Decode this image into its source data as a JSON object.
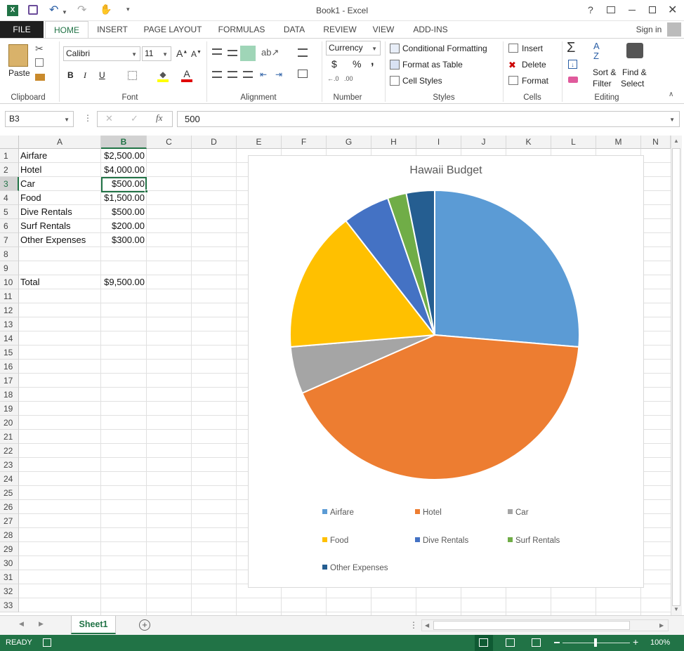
{
  "window": {
    "title": "Book1 - Excel",
    "help": "?",
    "signin": "Sign in"
  },
  "tabs": [
    "FILE",
    "HOME",
    "INSERT",
    "PAGE LAYOUT",
    "FORMULAS",
    "DATA",
    "REVIEW",
    "VIEW",
    "ADD-INS"
  ],
  "ribbon": {
    "clipboard": {
      "label": "Clipboard",
      "paste": "Paste"
    },
    "font": {
      "label": "Font",
      "name": "Calibri",
      "size": "11",
      "bold": "B",
      "italic": "I",
      "underline": "U"
    },
    "alignment": {
      "label": "Alignment"
    },
    "number": {
      "label": "Number",
      "format": "Currency",
      "currency_sym": "$",
      "percent_sym": "%",
      "comma_sym": ","
    },
    "styles": {
      "label": "Styles",
      "conditional": "Conditional Formatting",
      "format_table": "Format as Table",
      "cell_styles": "Cell Styles"
    },
    "cells": {
      "label": "Cells",
      "insert": "Insert",
      "delete": "Delete",
      "format": "Format"
    },
    "editing": {
      "label": "Editing",
      "sort1": "Sort &",
      "sort2": "Filter",
      "find1": "Find &",
      "find2": "Select"
    }
  },
  "formula_bar": {
    "name_box": "B3",
    "fx": "fx",
    "value": "500"
  },
  "columns": [
    "A",
    "B",
    "C",
    "D",
    "E",
    "F",
    "G",
    "H",
    "I",
    "J",
    "K",
    "L",
    "M",
    "N"
  ],
  "rows": [
    "1",
    "2",
    "3",
    "4",
    "5",
    "6",
    "7",
    "8",
    "9",
    "10",
    "11",
    "12",
    "13",
    "14",
    "15",
    "16",
    "17",
    "18",
    "19",
    "20",
    "21",
    "22",
    "23",
    "24",
    "25",
    "26",
    "27",
    "28",
    "29",
    "30",
    "31",
    "32",
    "33"
  ],
  "cells": [
    {
      "label": "Airfare",
      "value": "$2,500.00"
    },
    {
      "label": "Hotel",
      "value": "$4,000.00"
    },
    {
      "label": "Car",
      "value": "$500.00"
    },
    {
      "label": "Food",
      "value": "$1,500.00"
    },
    {
      "label": "Dive Rentals",
      "value": "$500.00"
    },
    {
      "label": "Surf Rentals",
      "value": "$200.00"
    },
    {
      "label": "Other Expenses",
      "value": "$300.00"
    },
    {
      "label": "",
      "value": ""
    },
    {
      "label": "",
      "value": ""
    },
    {
      "label": "Total",
      "value": "$9,500.00"
    }
  ],
  "chart_data": {
    "type": "pie",
    "title": "Hawaii Budget",
    "categories": [
      "Airfare",
      "Hotel",
      "Car",
      "Food",
      "Dive Rentals",
      "Surf Rentals",
      "Other Expenses"
    ],
    "values": [
      2500,
      4000,
      500,
      1500,
      500,
      200,
      300
    ],
    "colors": [
      "#5B9BD5",
      "#ED7D31",
      "#A5A5A5",
      "#FFC000",
      "#4472C4",
      "#70AD47",
      "#255E91"
    ],
    "legend_position": "bottom"
  },
  "sheet_tabs": [
    "Sheet1"
  ],
  "status": {
    "ready": "READY",
    "zoom": "100%"
  }
}
